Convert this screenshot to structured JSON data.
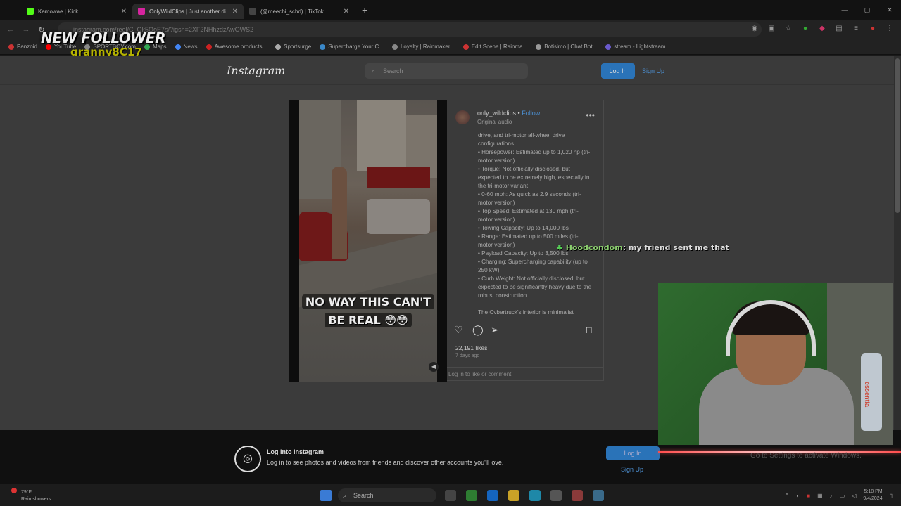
{
  "browser": {
    "tabs": [
      {
        "title": "Kamowae | Kick",
        "color": "#53fc18",
        "active": false
      },
      {
        "title": "OnlyWildClips | Just another di",
        "color": "#d6249f",
        "active": true
      },
      {
        "title": "(@meechi_scbd) | TikTok",
        "color": "#444444",
        "active": false
      }
    ],
    "new_tab": "+",
    "url": "instagram.com/reel/C_Ok5QoE7s/?igsh=2XF2NHhzdzAwOWS2",
    "bookmarks": [
      {
        "label": "Panzoid",
        "color": "#cc3333"
      },
      {
        "label": "YouTube",
        "color": "#ff0000"
      },
      {
        "label": "SPORTBOY.com",
        "color": "#888888"
      },
      {
        "label": "Maps",
        "color": "#34a853"
      },
      {
        "label": "News",
        "color": "#4285f4"
      },
      {
        "label": "Awesome products...",
        "color": "#cc2222"
      },
      {
        "label": "Sportsurge",
        "color": "#aaaaaa"
      },
      {
        "label": "Supercharge Your C...",
        "color": "#3a88c8"
      },
      {
        "label": "Loyalty | Rainmaker...",
        "color": "#888888"
      },
      {
        "label": "Edit Scene | Rainma...",
        "color": "#cc3333"
      },
      {
        "label": "Botisimo | Chat Bot...",
        "color": "#999999"
      },
      {
        "label": "stream - Lightstream",
        "color": "#6a5acd"
      }
    ]
  },
  "stream_overlay": {
    "alert_title": "NEW FOLLOWER",
    "alert_name": "granny8C17",
    "chat_user": "Hoodcondom",
    "chat_message": ": my friend sent me that"
  },
  "instagram": {
    "logo": "Instagram",
    "search_placeholder": "Search",
    "login_label": "Log In",
    "signup_label": "Sign Up",
    "post": {
      "username": "only_wildclips",
      "separator": "•",
      "follow_label": "Follow",
      "audio": "Original audio",
      "video_caption_line1": "NO WAY THIS CAN'T",
      "video_caption_line2": "BE REAL 😳😳",
      "description": [
        "drive, and tri-motor all-wheel drive configurations",
        "• Horsepower: Estimated up to 1,020 hp (tri-motor version)",
        "• Torque: Not officially disclosed, but expected to be extremely high, especially in the tri-motor variant",
        "• 0-60 mph: As quick as 2.9 seconds (tri-motor version)",
        "• Top Speed: Estimated at 130 mph (tri-motor version)",
        "• Towing Capacity: Up to 14,000 lbs",
        "• Range: Estimated up to 500 miles (tri-motor version)",
        "• Payload Capacity: Up to 3,500 lbs",
        "• Charging: Supercharging capability (up to 250 kW)",
        "• Curb Weight: Not officially disclosed, but expected to be significantly heavy due to the robust construction",
        "",
        "The Cybertruck's interior is minimalist"
      ],
      "likes": "22,191 likes",
      "time_ago": "7 days ago",
      "comment_prompt": "Log in to like or comment."
    },
    "login_bar": {
      "title": "Log into Instagram",
      "subtitle": "Log in to see photos and videos from friends and discover other accounts you'll love.",
      "login_label": "Log In",
      "signup_label": "Sign Up"
    },
    "windows_watermark": "Go to Settings to activate Windows."
  },
  "taskbar": {
    "temperature": "79°F",
    "weather": "Rain showers",
    "search_label": "Search",
    "time": "5:18 PM",
    "date": "9/4/2024",
    "bottle_label": "essentia"
  }
}
